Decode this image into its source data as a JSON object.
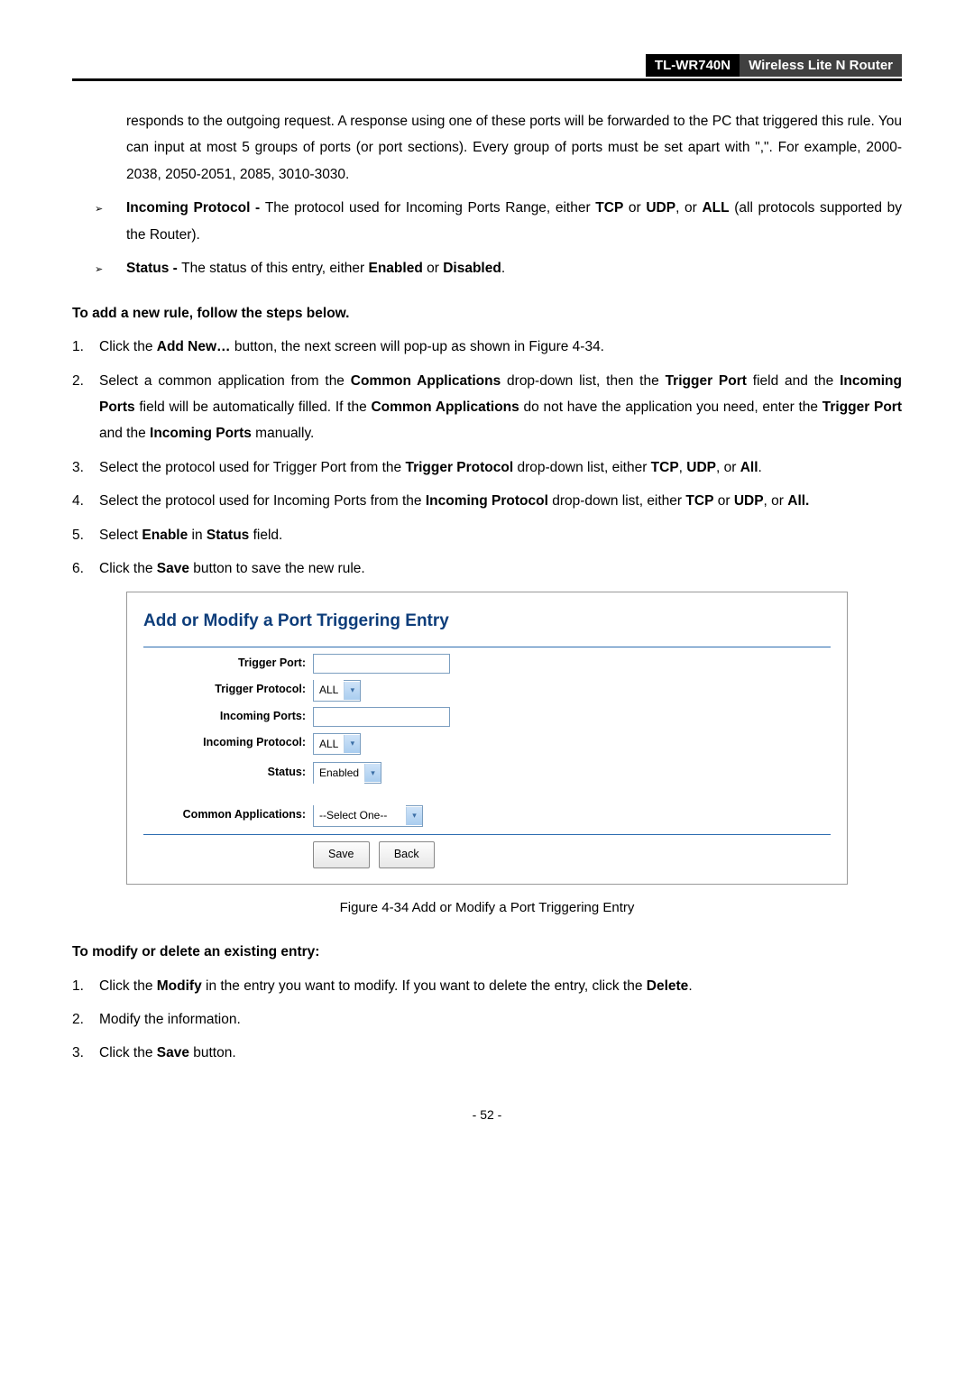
{
  "header": {
    "model": "TL-WR740N",
    "desc": "Wireless Lite N Router"
  },
  "para_continued": "responds to the outgoing request. A response using one of these ports will be forwarded to the PC that triggered this rule. You can input at most 5 groups of ports (or port sections). Every group of ports must be set apart with \",\". For example, 2000-2038, 2050-2051, 2085, 3010-3030.",
  "bullets": [
    {
      "label": "Incoming Protocol - ",
      "text": "The protocol used for Incoming Ports Range, either ",
      "bold2": "TCP",
      "mid2": " or ",
      "bold3": "UDP",
      "mid3": ", or ",
      "bold4": "ALL",
      "end": " (all protocols supported by the Router)."
    },
    {
      "label": "Status - ",
      "text": "The status of this entry, either ",
      "bold2": "Enabled",
      "mid2": " or ",
      "bold3": "Disabled",
      "end": "."
    }
  ],
  "section1_title": "To add a new rule, follow the steps below.",
  "steps": [
    {
      "n": "1.",
      "pre": "Click the ",
      "b1": "Add New…",
      "post": " button, the next screen will pop-up as shown in Figure 4-34."
    },
    {
      "n": "2.",
      "pre": "Select a common application from the ",
      "b1": "Common Applications",
      "mid1": " drop-down list, then the ",
      "b2": "Trigger Port",
      "mid2": " field and the ",
      "b3": "Incoming Ports",
      "mid3": " field will be automatically filled. If the ",
      "b4": "Common Applications",
      "mid4": " do not have the application you need, enter the ",
      "b5": "Trigger Port",
      "mid5": " and the ",
      "b6": "Incoming Ports",
      "post": " manually."
    },
    {
      "n": "3.",
      "pre": "Select the protocol used for Trigger Port from the ",
      "b1": "Trigger Protocol",
      "mid1": " drop-down list, either ",
      "b2": "TCP",
      "mid2": ", ",
      "b3": "UDP",
      "mid3": ", or ",
      "b4": "All",
      "post": "."
    },
    {
      "n": "4.",
      "pre": "Select the protocol used for Incoming Ports from the ",
      "b1": "Incoming Protocol",
      "mid1": " drop-down list, either ",
      "b2": "TCP",
      "mid2": " or ",
      "b3": "UDP",
      "mid3": ", or ",
      "b4": "All.",
      "post": ""
    },
    {
      "n": "5.",
      "pre": "Select ",
      "b1": "Enable",
      "mid1": " in ",
      "b2": "Status",
      "post": " field."
    },
    {
      "n": "6.",
      "pre": "Click the ",
      "b1": "Save",
      "post": " button to save the new rule."
    }
  ],
  "figure": {
    "title": "Add or Modify a Port Triggering Entry",
    "labels": {
      "trigger_port": "Trigger Port:",
      "trigger_protocol": "Trigger Protocol:",
      "incoming_ports": "Incoming Ports:",
      "incoming_protocol": "Incoming Protocol:",
      "status": "Status:",
      "common_apps": "Common Applications:"
    },
    "values": {
      "trigger_protocol": "ALL",
      "incoming_protocol": "ALL",
      "status": "Enabled",
      "common_apps": "--Select One--"
    },
    "buttons": {
      "save": "Save",
      "back": "Back"
    }
  },
  "figure_caption": "Figure 4-34    Add or Modify a Port Triggering Entry",
  "section2_title": "To modify or delete an existing entry:",
  "steps2": [
    {
      "n": "1.",
      "pre": "Click the ",
      "b1": "Modify",
      "mid1": " in the entry you want to modify. If you want to delete the entry, click the ",
      "b2": "Delete",
      "post": "."
    },
    {
      "n": "2.",
      "pre": "Modify the information.",
      "post": ""
    },
    {
      "n": "3.",
      "pre": "Click the ",
      "b1": "Save",
      "post": " button."
    }
  ],
  "page_num": "- 52 -"
}
